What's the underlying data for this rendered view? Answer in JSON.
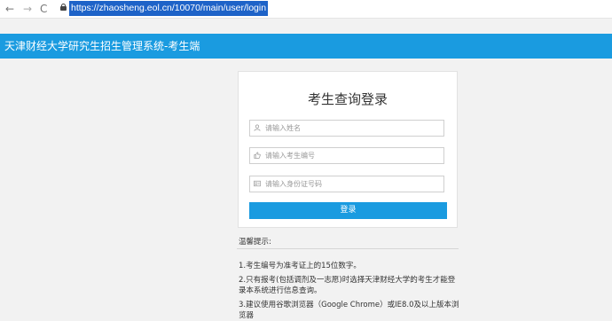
{
  "browser": {
    "back_glyph": "←",
    "forward_glyph": "→",
    "reload_glyph": "C",
    "url": "https://zhaosheng.eol.cn/10070/main/user/login"
  },
  "header": {
    "title": "天津财经大学研究生招生管理系统-考生端",
    "color": "#1a9be0"
  },
  "login": {
    "title": "考生查询登录",
    "name_placeholder": "请输入姓名",
    "number_placeholder": "请输入考生编号",
    "id_placeholder": "请输入身份证号码",
    "button_label": "登录"
  },
  "notes": {
    "title": "温馨提示:",
    "items": [
      "1.考生编号为准考证上的15位数字。",
      "2.只有报考(包括调剂及一志愿)时选择天津财经大学的考生才能登录本系统进行信息查询。",
      "3.建议使用谷歌浏览器（Google Chrome）或IE8.0及以上版本浏览器"
    ]
  }
}
